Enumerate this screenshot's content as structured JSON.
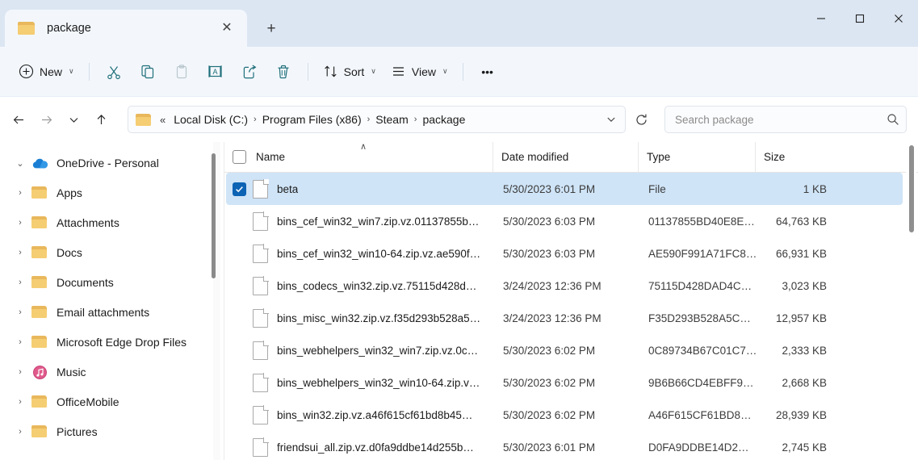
{
  "window": {
    "tab_title": "package",
    "tab_close_label": "✕",
    "new_tab_label": "+",
    "minimize_label": "minimize",
    "maximize_label": "maximize",
    "close_label": "close"
  },
  "toolbar": {
    "new_label": "New",
    "cut_label": "Cut",
    "copy_label": "Copy",
    "paste_label": "Paste",
    "rename_label": "Rename",
    "share_label": "Share",
    "delete_label": "Delete",
    "sort_label": "Sort",
    "view_label": "View",
    "more_label": "•••",
    "chevron": "∨"
  },
  "address": {
    "back_label": "Back",
    "forward_label": "Forward",
    "recent_label": "Recent locations",
    "up_label": "Up",
    "overflow": "«",
    "separator": "›",
    "crumbs": [
      "Local Disk (C:)",
      "Program Files (x86)",
      "Steam",
      "package"
    ],
    "dropdown": "∨",
    "refresh_label": "Refresh"
  },
  "search": {
    "placeholder": "Search package",
    "value": ""
  },
  "sidebar": {
    "root": {
      "label": "OneDrive - Personal",
      "twisty": "⌄",
      "icon": "cloud-icon"
    },
    "items": [
      {
        "label": "Apps",
        "icon": "folder-icon",
        "twisty": "›"
      },
      {
        "label": "Attachments",
        "icon": "folder-icon",
        "twisty": "›"
      },
      {
        "label": "Docs",
        "icon": "folder-icon",
        "twisty": "›"
      },
      {
        "label": "Documents",
        "icon": "folder-icon",
        "twisty": "›"
      },
      {
        "label": "Email attachments",
        "icon": "folder-icon",
        "twisty": "›"
      },
      {
        "label": "Microsoft Edge Drop Files",
        "icon": "folder-icon",
        "twisty": "›"
      },
      {
        "label": "Music",
        "icon": "music-icon",
        "twisty": "›"
      },
      {
        "label": "OfficeMobile",
        "icon": "folder-icon",
        "twisty": "›"
      },
      {
        "label": "Pictures",
        "icon": "folder-icon",
        "twisty": "›"
      }
    ]
  },
  "filelist": {
    "sort_caret": "∧",
    "columns": {
      "name": "Name",
      "date_modified": "Date modified",
      "type": "Type",
      "size": "Size"
    },
    "rows": [
      {
        "name": "beta",
        "date": "5/30/2023 6:01 PM",
        "type": "File",
        "size": "1 KB",
        "selected": true
      },
      {
        "name": "bins_cef_win32_win7.zip.vz.01137855b…",
        "date": "5/30/2023 6:03 PM",
        "type": "01137855BD40E8E…",
        "size": "64,763 KB",
        "selected": false
      },
      {
        "name": "bins_cef_win32_win10-64.zip.vz.ae590f…",
        "date": "5/30/2023 6:03 PM",
        "type": "AE590F991A71FC8…",
        "size": "66,931 KB",
        "selected": false
      },
      {
        "name": "bins_codecs_win32.zip.vz.75115d428d…",
        "date": "3/24/2023 12:36 PM",
        "type": "75115D428DAD4C…",
        "size": "3,023 KB",
        "selected": false
      },
      {
        "name": "bins_misc_win32.zip.vz.f35d293b528a5…",
        "date": "3/24/2023 12:36 PM",
        "type": "F35D293B528A5C…",
        "size": "12,957 KB",
        "selected": false
      },
      {
        "name": "bins_webhelpers_win32_win7.zip.vz.0c…",
        "date": "5/30/2023 6:02 PM",
        "type": "0C89734B67C01C7…",
        "size": "2,333 KB",
        "selected": false
      },
      {
        "name": "bins_webhelpers_win32_win10-64.zip.v…",
        "date": "5/30/2023 6:02 PM",
        "type": "9B6B66CD4EBFF9…",
        "size": "2,668 KB",
        "selected": false
      },
      {
        "name": "bins_win32.zip.vz.a46f615cf61bd8b45…",
        "date": "5/30/2023 6:02 PM",
        "type": "A46F615CF61BD8…",
        "size": "28,939 KB",
        "selected": false
      },
      {
        "name": "friendsui_all.zip.vz.d0fa9ddbe14d255b…",
        "date": "5/30/2023 6:01 PM",
        "type": "D0FA9DDBE14D2…",
        "size": "2,745 KB",
        "selected": false
      }
    ]
  },
  "colors": {
    "titlebar_bg": "#dce6f2",
    "toolbar_bg": "#f3f7fc",
    "selection_bg": "#cfe4f7",
    "checkbox_blue": "#0d63b4",
    "folder_yellow": "#f5cd73",
    "onedrive_blue": "#1a7fd4",
    "accent_teal": "#1f6f7a"
  }
}
